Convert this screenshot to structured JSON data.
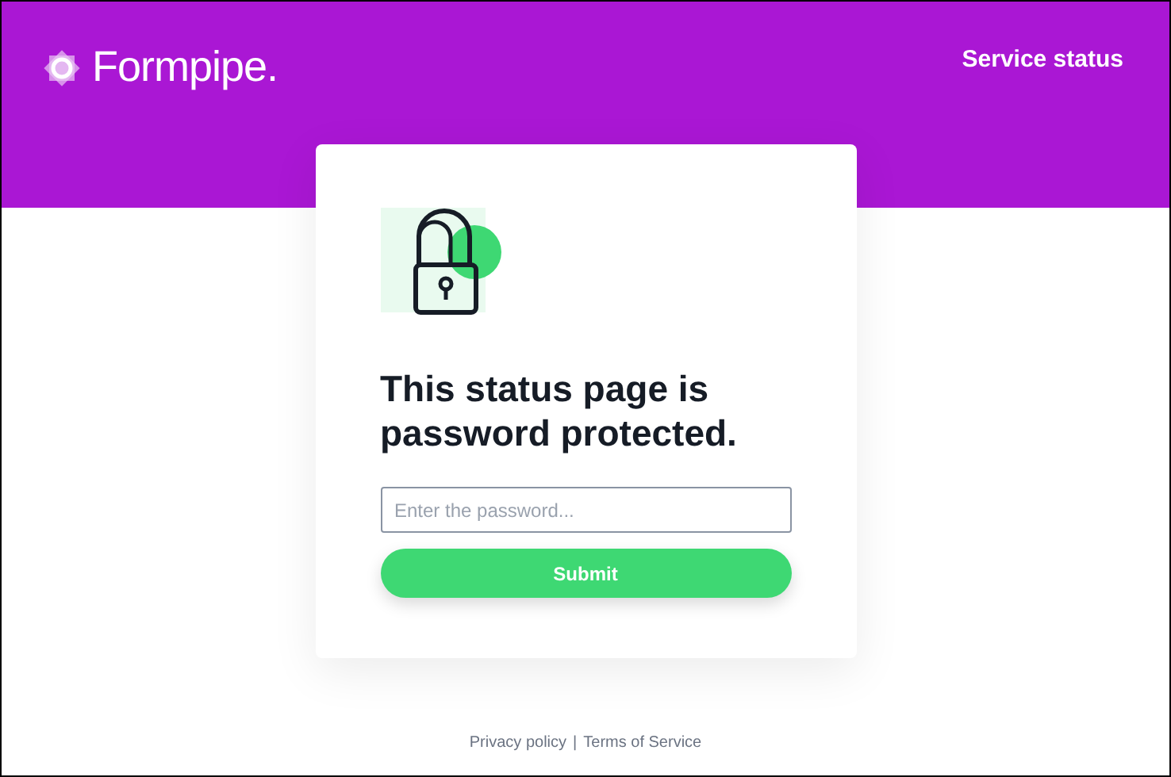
{
  "header": {
    "logo_text": "Formpipe.",
    "link": "Service status"
  },
  "card": {
    "heading": "This status page is password protected.",
    "password_field": {
      "placeholder": "Enter the password..."
    },
    "button": "Submit"
  },
  "footer": {
    "links": [
      "Privacy policy",
      "Terms of Service"
    ],
    "separator": "|"
  }
}
